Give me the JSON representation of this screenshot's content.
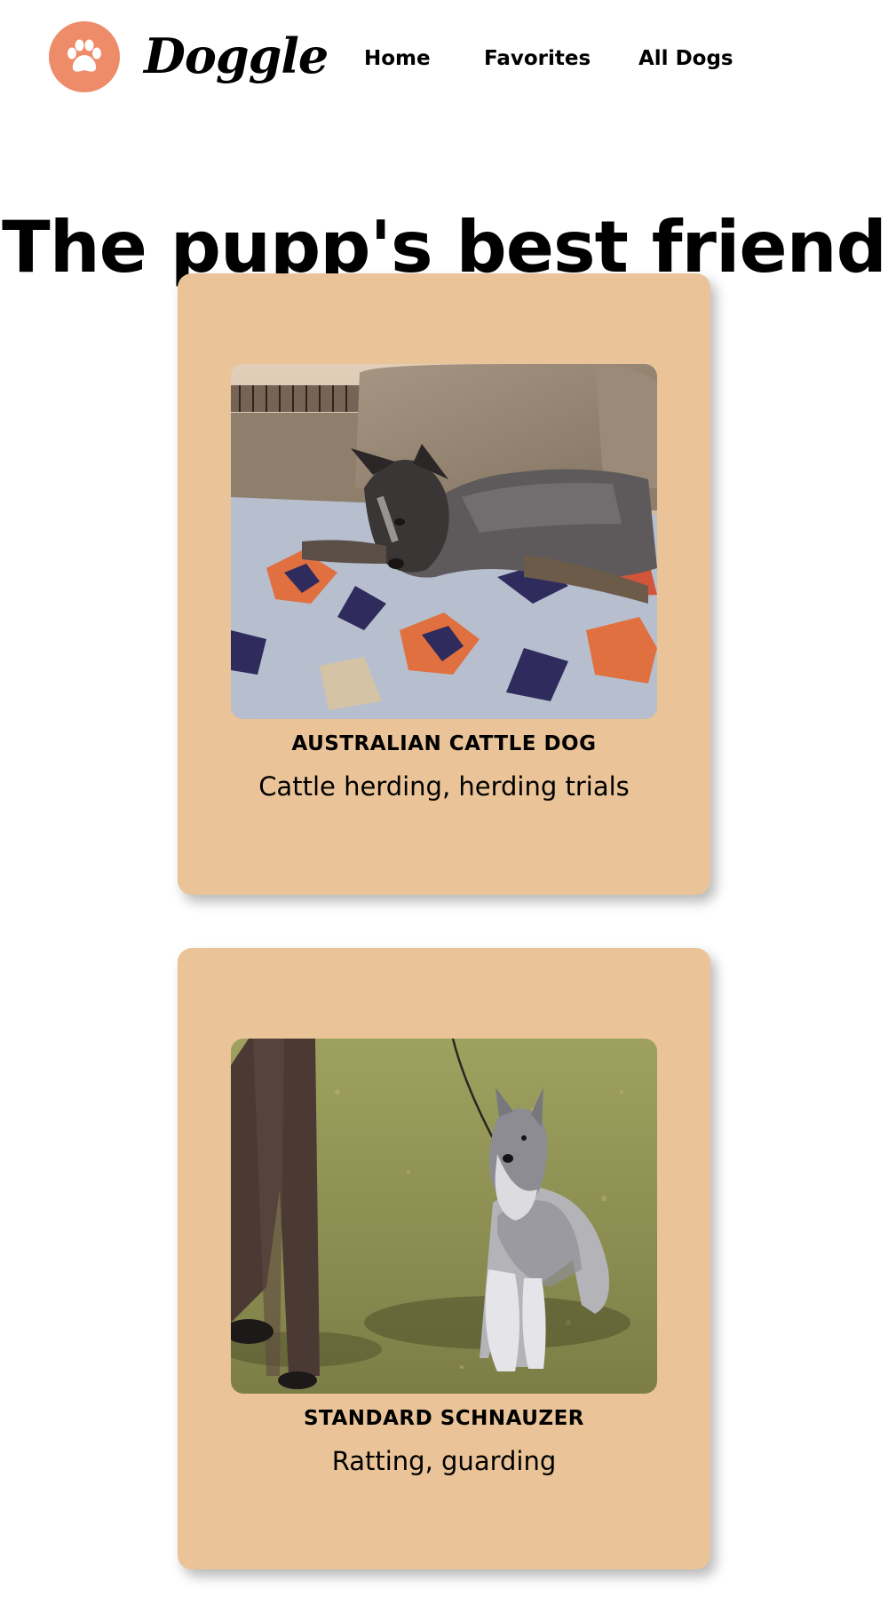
{
  "brand": {
    "name": "Doggle",
    "logo_icon": "paw-icon",
    "logo_color": "#ee8c69"
  },
  "nav": {
    "items": [
      {
        "label": "Home"
      },
      {
        "label": "Favorites"
      },
      {
        "label": "All Dogs"
      }
    ]
  },
  "hero": {
    "title": "The pupp's best friend"
  },
  "colors": {
    "card_background": "#eac498",
    "page_background": "#ffffff"
  },
  "dogs": [
    {
      "breed": "AUSTRALIAN CATTLE DOG",
      "bred_for": "Cattle herding, herding trials",
      "photo": "dog-on-couch-photo"
    },
    {
      "breed": "STANDARD SCHNAUZER",
      "bred_for": "Ratting, guarding",
      "photo": "schnauzer-on-grass-photo"
    }
  ]
}
